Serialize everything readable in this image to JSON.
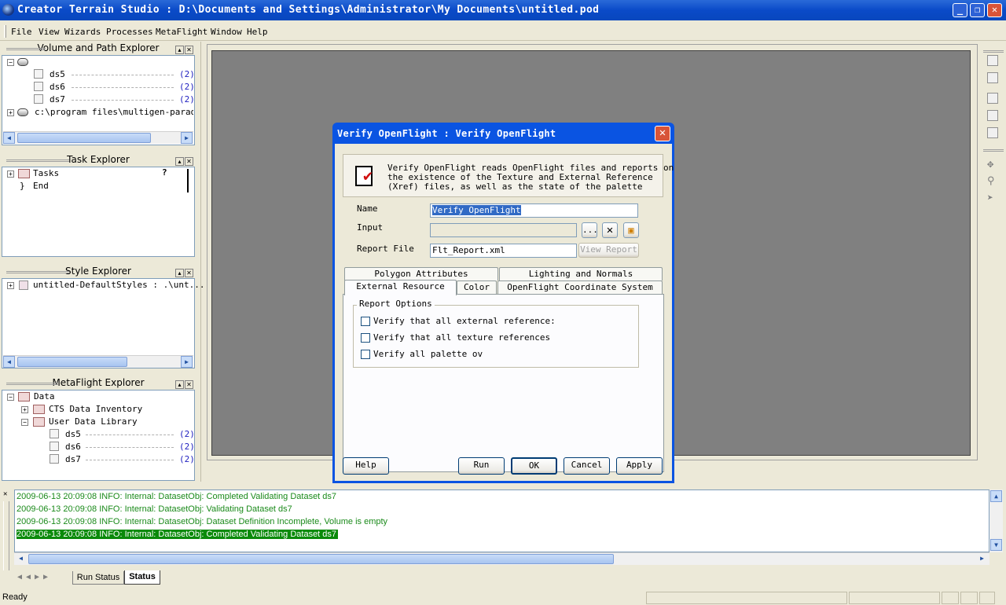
{
  "app": {
    "title": "Creator Terrain Studio : D:\\Documents and Settings\\Administrator\\My Documents\\untitled.pod",
    "window_buttons": {
      "minimize": "_",
      "restore": "❐",
      "close": "✕"
    }
  },
  "menu": {
    "items": [
      {
        "label": "File"
      },
      {
        "label": "View"
      },
      {
        "label": "Wizards"
      },
      {
        "label": "Processes"
      },
      {
        "label": "MetaFlight"
      },
      {
        "label": "Window"
      },
      {
        "label": "Help"
      }
    ]
  },
  "volume_explorer": {
    "title": "Volume and Path Explorer",
    "items": [
      {
        "label": "ds5",
        "count": "(2)"
      },
      {
        "label": "ds6",
        "count": "(2)"
      },
      {
        "label": "ds7",
        "count": "(2)"
      }
    ],
    "path": "c:\\program files\\multigen-paradigm"
  },
  "task_explorer": {
    "title": "Task Explorer",
    "tasks_label": "Tasks",
    "end_label": "End",
    "help_glyph": "?"
  },
  "style_explorer": {
    "title": "Style Explorer",
    "item": "untitled-DefaultStyles : .\\unt..."
  },
  "metaflight_explorer": {
    "title": "MetaFlight Explorer",
    "root": "Data",
    "inventory": "CTS Data Inventory",
    "library": "User Data Library",
    "items": [
      {
        "label": "ds5",
        "count": "(2)"
      },
      {
        "label": "ds6",
        "count": "(2)"
      },
      {
        "label": "ds7",
        "count": "(2)"
      }
    ]
  },
  "dialog": {
    "title": "Verify OpenFlight : Verify OpenFlight",
    "description_lines": [
      "Verify OpenFlight reads OpenFlight files and reports on",
      "the existence of the Texture and External Reference",
      "(Xref) files, as well as the state of the palette"
    ],
    "name_label": "Name",
    "name_value": "Verify OpenFlight",
    "input_label": "Input",
    "input_value": "",
    "browse_label": "...",
    "report_label": "Report File",
    "report_value": "Flt_Report.xml",
    "view_report_label": "View Report",
    "tabs_row1": [
      {
        "label": "Polygon Attributes"
      },
      {
        "label": "Lighting and Normals"
      }
    ],
    "tabs_row2": [
      {
        "label": "External Resource"
      },
      {
        "label": "Color"
      },
      {
        "label": "OpenFlight Coordinate System"
      }
    ],
    "group_label": "Report Options",
    "options": [
      {
        "label": "Verify that all external reference:"
      },
      {
        "label": "Verify that all texture references"
      },
      {
        "label": "Verify all palette ov"
      }
    ],
    "buttons": {
      "help": "Help",
      "run": "Run",
      "ok": "OK",
      "cancel": "Cancel",
      "apply": "Apply"
    }
  },
  "output": {
    "lines": [
      "2009-06-13 20:09:08 INFO: Internal: DatasetObj: Completed Validating Dataset ds7",
      "2009-06-13 20:09:08 INFO: Internal: DatasetObj: Validating Dataset ds7",
      "2009-06-13 20:09:08 INFO: Internal: DatasetObj: Dataset Definition Incomplete, Volume is empty",
      "2009-06-13 20:09:08 INFO: Internal: DatasetObj: Completed Validating Dataset ds7"
    ],
    "tabs": [
      {
        "label": "Run Status"
      },
      {
        "label": "Status"
      }
    ]
  },
  "status": {
    "text": "Ready"
  },
  "colors": {
    "title_blue": "#0a4ac8",
    "log_green": "#1a8a1a",
    "selected_green": "#0a8a0a",
    "count_blue": "#2020c0"
  }
}
